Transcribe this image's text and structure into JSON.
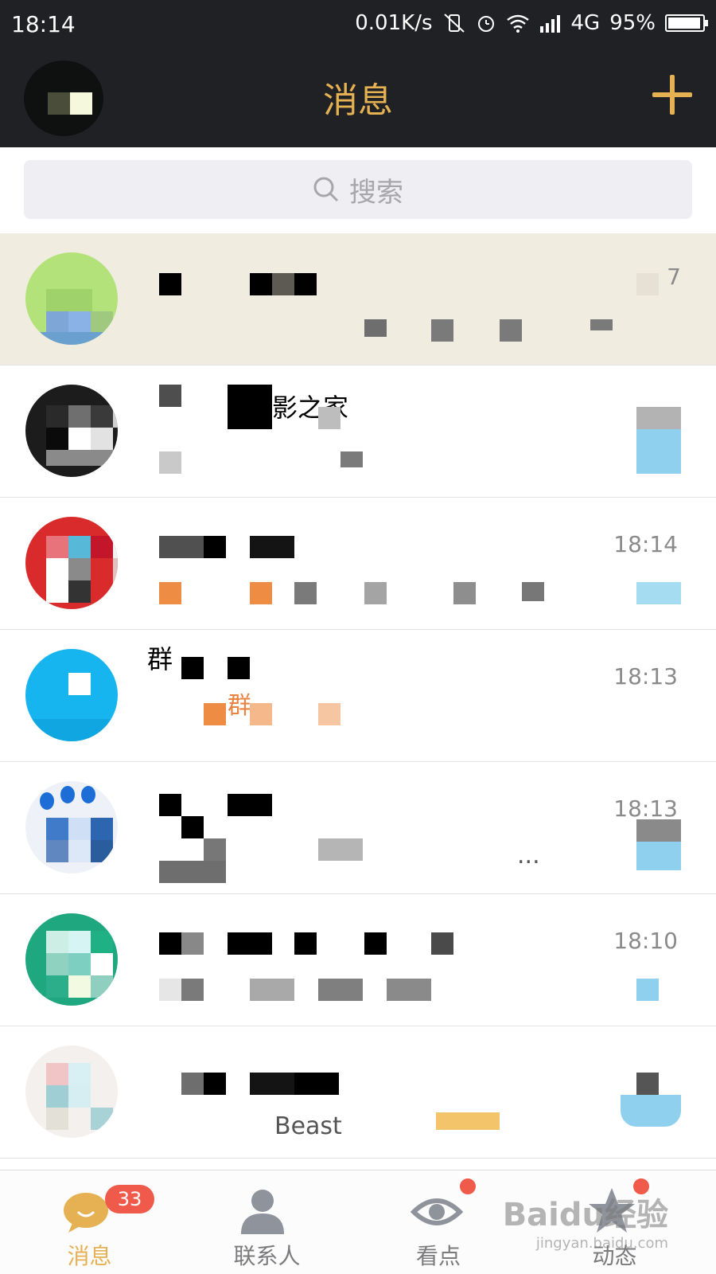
{
  "status_bar": {
    "time": "18:14",
    "speed": "0.01K/s",
    "network": "4G",
    "battery": "95%",
    "battery_level": 0.95
  },
  "header": {
    "title": "消息",
    "add_icon": "plus-icon"
  },
  "search": {
    "placeholder": "搜索"
  },
  "conversations": [
    {
      "name": "",
      "preview": "",
      "time": "7",
      "pinned": true
    },
    {
      "name": "影之家",
      "preview": "",
      "time": "",
      "pinned": false
    },
    {
      "name": "",
      "preview": "",
      "time": "18:14",
      "pinned": false
    },
    {
      "name": "群",
      "preview": "群",
      "time": "18:13",
      "pinned": false
    },
    {
      "name": "",
      "preview": "...",
      "time": "18:13",
      "pinned": false
    },
    {
      "name": "",
      "preview": "",
      "time": "18:10",
      "pinned": false
    },
    {
      "name": "",
      "preview": "Beast",
      "time": "",
      "pinned": false
    }
  ],
  "bottom_nav": [
    {
      "label": "消息",
      "icon": "message-icon",
      "badge": "33",
      "active": true
    },
    {
      "label": "联系人",
      "icon": "contacts-icon",
      "badge": "",
      "active": false
    },
    {
      "label": "看点",
      "icon": "eye-icon",
      "badge": "",
      "active": false
    },
    {
      "label": "动态",
      "icon": "star-icon",
      "badge": "",
      "active": false
    }
  ],
  "watermark": {
    "main": "Baidu经验",
    "sub": "jingyan.baidu.com"
  },
  "colors": {
    "accent": "#e5b153",
    "dark_bar": "#1f2124",
    "pinned_bg": "#f1ece0",
    "badge_red": "#f05a4a"
  }
}
